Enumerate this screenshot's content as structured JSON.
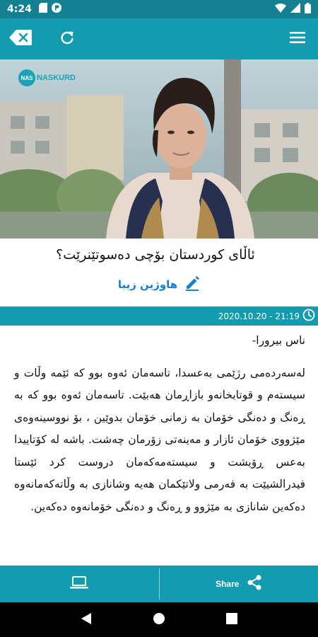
{
  "status_bar": {
    "time": "4:24"
  },
  "app_bar": {
    "accent": "#139bb0"
  },
  "hero": {
    "logo_text": "NASKURD"
  },
  "article": {
    "title": "ئاڵای کوردستان بۆچی دەسوتێنرێت؟",
    "author": "هاوژین زیبا",
    "datetime": "2020.10.20 - 21:19",
    "paragraphs": [
      "ناس بیرورا-",
      "لەسەردەمی رژێمی بەعسدا، تاسەمان ئەوە بوو کە ئێمە وڵات و سیستەم و قوتابخانەو بازاڕمان هەبێت. تاسەمان ئەوە بوو کە بە ڕەنگ و دەنگی خۆمان بە زمانی خۆمان بدوێین ، بۆ نووسینەوەی مێژووی خۆمان ئازار و مەینەتی زۆرمان چەشت. باشە لە کۆتاییدا بەعس ڕۆیشت و سیستەمەکەمان دروست کرد ئێستا فیدرالشیێت بە فەرمی ولاتێکمان هەیە وشانازی بە وڵاتەکەمانەوە دەکەین شانازی بە مێژوو و ڕەنگ و دەنگی خۆمانەوە دەکەین."
    ]
  },
  "bottom_bar": {
    "share_label": "Share"
  }
}
